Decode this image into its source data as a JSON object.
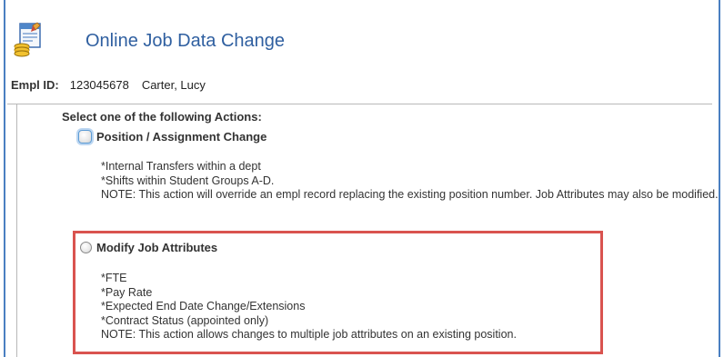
{
  "header": {
    "title": "Online Job Data Change",
    "icon": "job-data-icon"
  },
  "employee": {
    "label": "Empl ID:",
    "id": "123045678",
    "name": "Carter, Lucy"
  },
  "actions": {
    "heading": "Select one of the following Actions:",
    "options": [
      {
        "label": "Position / Assignment Change",
        "selected": false,
        "focused": true,
        "lines": [
          "*Internal Transfers within a dept",
          "*Shifts within Student Groups A-D."
        ],
        "note": "NOTE: This action will override an empl record replacing the existing position number. Job Attributes may also be modified."
      },
      {
        "label": "Modify Job Attributes",
        "selected": false,
        "focused": false,
        "highlighted": true,
        "lines": [
          "*FTE",
          "*Pay Rate",
          "*Expected End Date Change/Extensions",
          "*Contract Status (appointed only)"
        ],
        "note": "NOTE: This action allows changes to multiple job attributes on an existing position."
      }
    ]
  },
  "colors": {
    "title": "#2f5fa0",
    "frame": "#4a7fc1",
    "highlight": "#d9534f"
  }
}
